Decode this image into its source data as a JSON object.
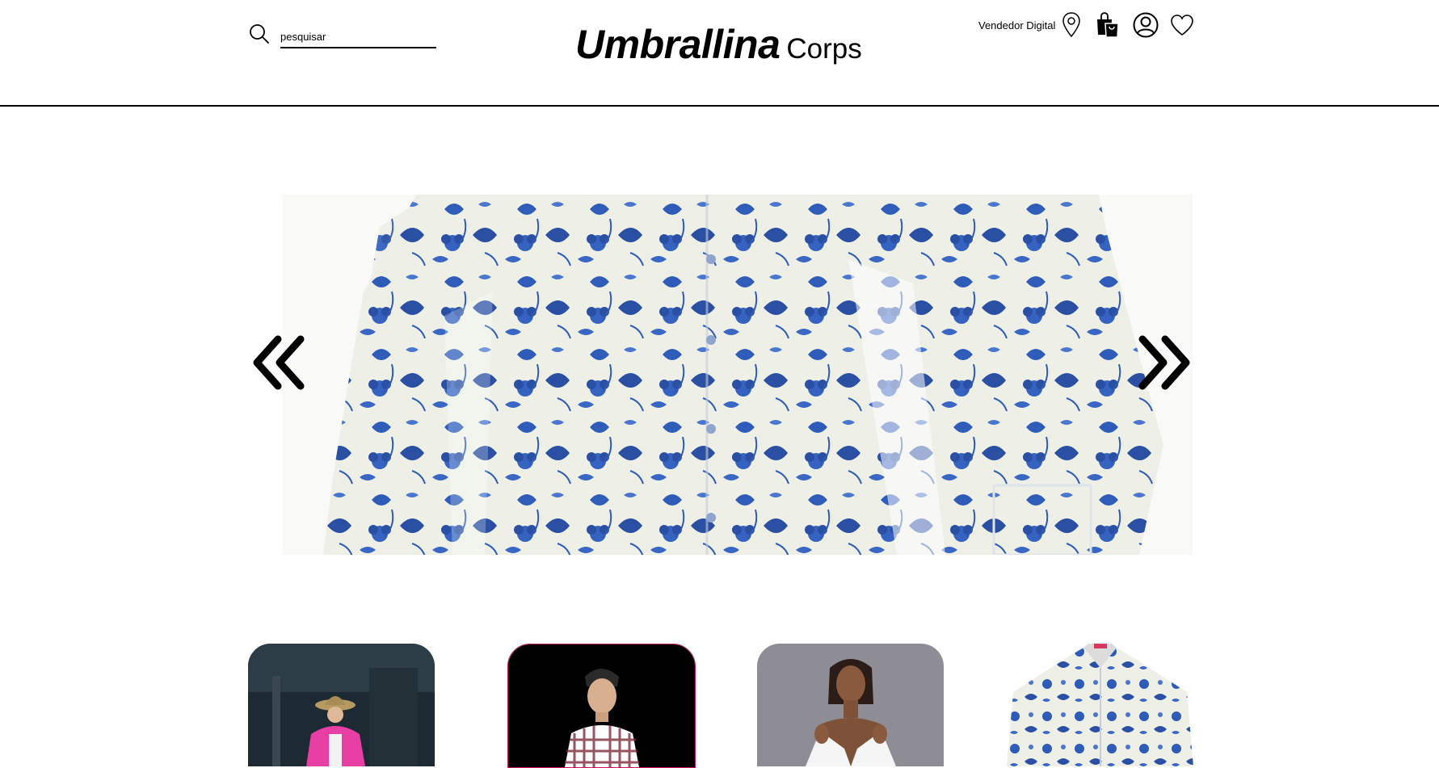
{
  "header": {
    "search": {
      "value": "pesquisar",
      "icon": "search-icon"
    },
    "brand": {
      "main": "Umbrallina",
      "sub": "Corps"
    },
    "nav": {
      "vendor_label": "Vendedor Digital",
      "icons": [
        "location-pin-icon",
        "shopping-bag-icon",
        "user-profile-icon",
        "heart-icon"
      ]
    }
  },
  "carousel": {
    "prev_icon": "double-chevron-left-icon",
    "next_icon": "double-chevron-right-icon",
    "banner": "blue floral print blouse"
  },
  "products": [
    {
      "image": "woman in pink jacket and bucket hat"
    },
    {
      "image": "man in plaid shirt"
    },
    {
      "image": "woman in white off-shoulder shirt"
    },
    {
      "image": "blue floral print shirt"
    }
  ],
  "colors": {
    "accent": "#2f5cb8",
    "text": "#000000",
    "background": "#ffffff"
  }
}
